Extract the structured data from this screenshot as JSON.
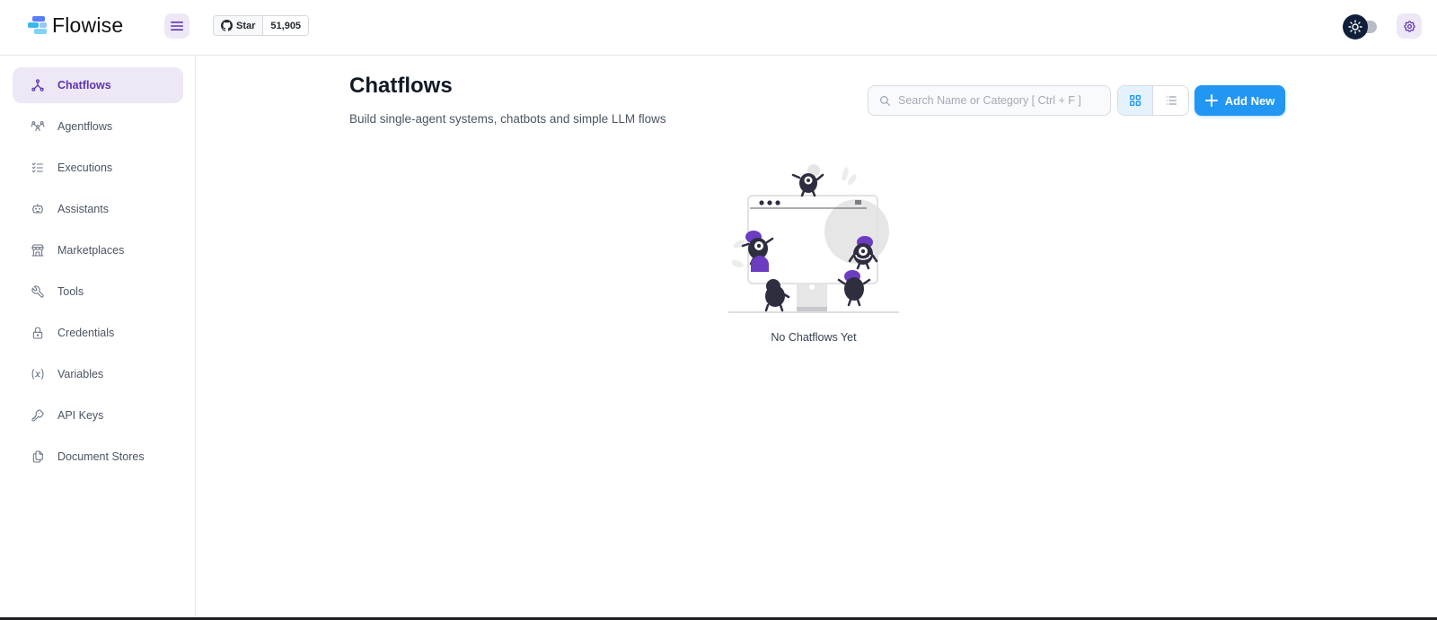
{
  "header": {
    "brand": "Flowise",
    "github": {
      "star_label": "Star",
      "star_count": "51,905"
    }
  },
  "sidebar": {
    "items": [
      {
        "label": "Chatflows",
        "icon": "hierarchy-icon",
        "active": true
      },
      {
        "label": "Agentflows",
        "icon": "users-group-icon",
        "active": false
      },
      {
        "label": "Executions",
        "icon": "list-check-icon",
        "active": false
      },
      {
        "label": "Assistants",
        "icon": "robot-icon",
        "active": false
      },
      {
        "label": "Marketplaces",
        "icon": "building-store-icon",
        "active": false
      },
      {
        "label": "Tools",
        "icon": "tool-icon",
        "active": false
      },
      {
        "label": "Credentials",
        "icon": "lock-icon",
        "active": false
      },
      {
        "label": "Variables",
        "icon": "variable-icon",
        "active": false
      },
      {
        "label": "API Keys",
        "icon": "key-icon",
        "active": false
      },
      {
        "label": "Document Stores",
        "icon": "files-icon",
        "active": false
      }
    ]
  },
  "main": {
    "title": "Chatflows",
    "subtitle": "Build single-agent systems, chatbots and simple LLM flows",
    "search": {
      "placeholder": "Search Name or Category [ Ctrl + F ]",
      "value": ""
    },
    "add_button": "Add New",
    "empty_state": "No Chatflows Yet"
  },
  "colors": {
    "accent": "#5e35b1",
    "accent_light": "#ede7f6",
    "primary": "#2196f3",
    "primary_light": "#e3f2fd"
  }
}
